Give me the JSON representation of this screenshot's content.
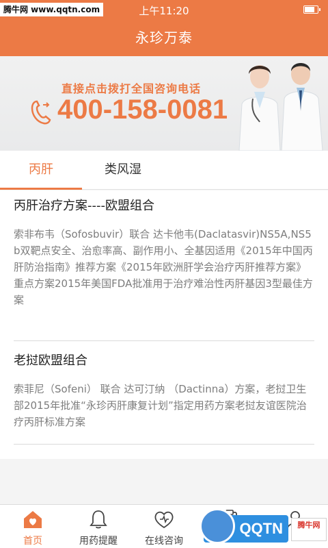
{
  "status_bar": {
    "watermark": "腾牛网 www.qqtn.com",
    "time": "上午11:20",
    "battery_level": 0.85
  },
  "header": {
    "title": "永珍万泰"
  },
  "banner": {
    "tagline": "直接点击拨打全国咨询电话",
    "phone_number": "400-158-0081"
  },
  "tabs": [
    {
      "label": "丙肝",
      "active": true
    },
    {
      "label": "类风湿",
      "active": false
    }
  ],
  "articles": [
    {
      "title": "丙肝治疗方案----欧盟组合",
      "description": "索非布韦（Sofosbuvir）联合 达卡他韦(Daclatasvir)NS5A,NS5b双靶点安全、治愈率高、副作用小、全基因适用《2015年中国丙肝防治指南》推荐方案《2015年欧洲肝学会治疗丙肝推荐方案》重点方案2015年美国FDA批准用于治疗难治性丙肝基因3型最佳方案"
    },
    {
      "title": "老挝欧盟组合",
      "description": "索菲尼（Sofeni） 联合 达可汀纳 （Dactinna）方案，老挝卫生部2015年批准“永珍丙肝康复计划”指定用药方案老挝友谊医院治疗丙肝标准方案"
    }
  ],
  "bottom_nav": [
    {
      "label": "首页",
      "icon": "home-heart-icon",
      "active": true
    },
    {
      "label": "用药提醒",
      "icon": "bell-icon",
      "active": false
    },
    {
      "label": "在线咨询",
      "icon": "heart-chat-icon",
      "active": false
    }
  ],
  "corner_logo": {
    "brand_text": "QQTN",
    "side_text": "腾牛网"
  },
  "colors": {
    "accent": "#ec7a45",
    "text_primary": "#222222",
    "text_secondary": "#7d7d7d"
  }
}
